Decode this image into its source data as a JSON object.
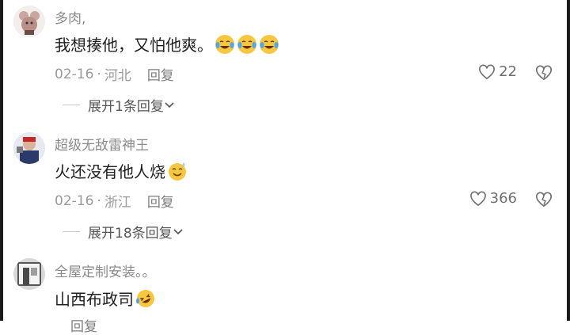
{
  "comments": [
    {
      "username": "多肉,",
      "content": "我想揍他，又怕他爽。",
      "emojis": [
        "laugh-cry",
        "laugh-cry",
        "laugh-cry"
      ],
      "date": "02-16",
      "location": "河北",
      "reply_label": "回复",
      "likes": "22",
      "expand_label": "展开1条回复"
    },
    {
      "username": "超级无敌雷神王",
      "content": "火还没有他人烧",
      "emojis": [
        "sweat-smile"
      ],
      "date": "02-16",
      "location": "浙江",
      "reply_label": "回复",
      "likes": "366",
      "expand_label": "展开18条回复"
    },
    {
      "username": "全屋定制安装。。",
      "content": "山西布政司",
      "emojis": [
        "rofl"
      ],
      "date": "",
      "location": "",
      "reply_label": "回复",
      "likes": ""
    }
  ],
  "separator": "·",
  "colors": {
    "text": "#1f1f1f",
    "muted": "#9a9a9a",
    "username": "#8a8a8a"
  }
}
